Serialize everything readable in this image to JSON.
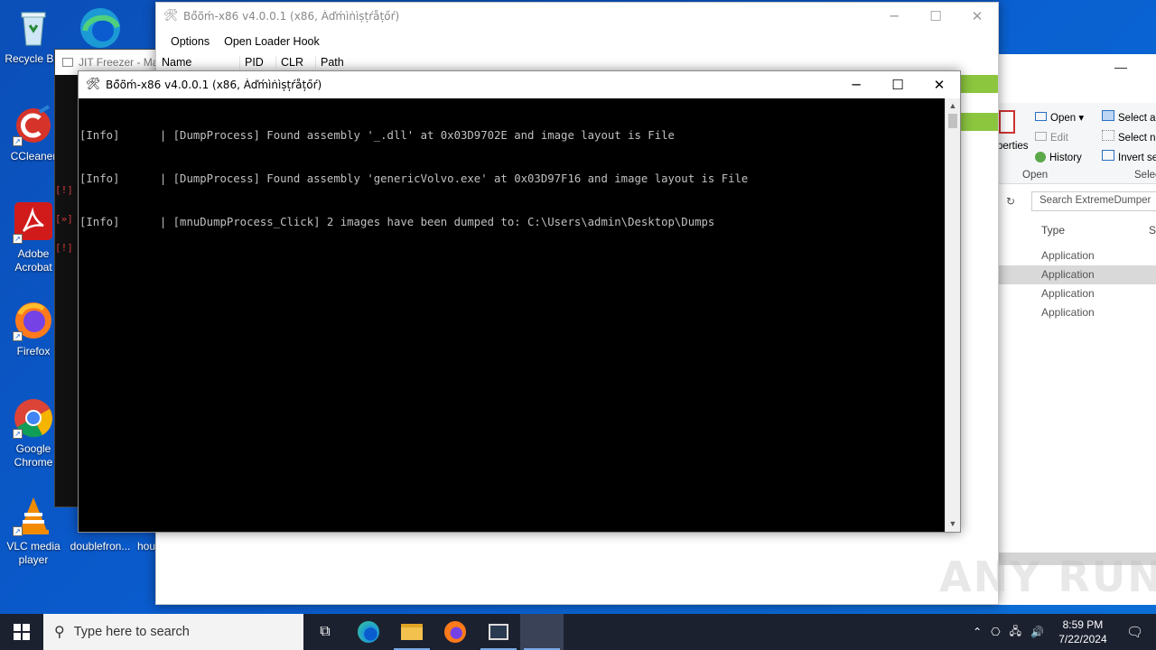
{
  "desktop": {
    "icons": [
      {
        "label": "Recycle Bin",
        "icon": "recycle-bin-icon"
      },
      {
        "label": "CCleaner",
        "icon": "ccleaner-icon"
      },
      {
        "label": "Adobe Acrobat",
        "icon": "adobe-acrobat-icon"
      },
      {
        "label": "Firefox",
        "icon": "firefox-icon"
      },
      {
        "label": "Google Chrome",
        "icon": "chrome-icon"
      },
      {
        "label": "VLC media player",
        "icon": "vlc-icon"
      },
      {
        "label": "doublefron...",
        "icon": "file-icon"
      },
      {
        "label": "hou",
        "icon": "file-icon"
      }
    ],
    "watermark": "ANY RUN"
  },
  "jit_window": {
    "title": "JIT Freezer - Ma",
    "markers": [
      "[!]",
      "[»]",
      "[!]"
    ]
  },
  "boom_main": {
    "title": "Bő̈ö̈ḿ-x86 v4.0.0.1 (x86, Àďḿìṅìșțŕåțőŕ)",
    "menu": [
      "Options",
      "Open Loader Hook"
    ],
    "columns": [
      "Name",
      "PID",
      "CLR",
      "Path"
    ]
  },
  "console": {
    "title": "Bő̈ö̈ḿ-x86 v4.0.0.1 (x86, Àďḿìṅìșțŕåțőŕ)",
    "lines": [
      "[Info]      | [DumpProcess] Found assembly '_.dll' at 0x03D9702E and image layout is File",
      "[Info]      | [DumpProcess] Found assembly 'genericVolvo.exe' at 0x03D97F16 and image layout is File",
      "[Info]      | [mnuDumpProcess_Click] 2 images have been dumped to: C:\\Users\\admin\\Desktop\\Dumps"
    ]
  },
  "explorer": {
    "ribbon": {
      "open_group": [
        "Open ▾",
        "Edit",
        "History"
      ],
      "open_group_label": "Open",
      "select_group": [
        "Select a",
        "Select n",
        "Invert se"
      ],
      "select_group_label": "Selec",
      "properties_label": "perties"
    },
    "search_placeholder": "Search ExtremeDumper",
    "column_type": "Type",
    "column_size": "S",
    "rows": [
      "Application",
      "Application",
      "Application",
      "Application"
    ]
  },
  "taskbar": {
    "search_placeholder": "Type here to search",
    "time": "8:59 PM",
    "date": "7/22/2024"
  },
  "colors": {
    "accent_green": "#8cc63f",
    "console_bg": "#000000",
    "taskbar_bg": "#1c2130"
  }
}
